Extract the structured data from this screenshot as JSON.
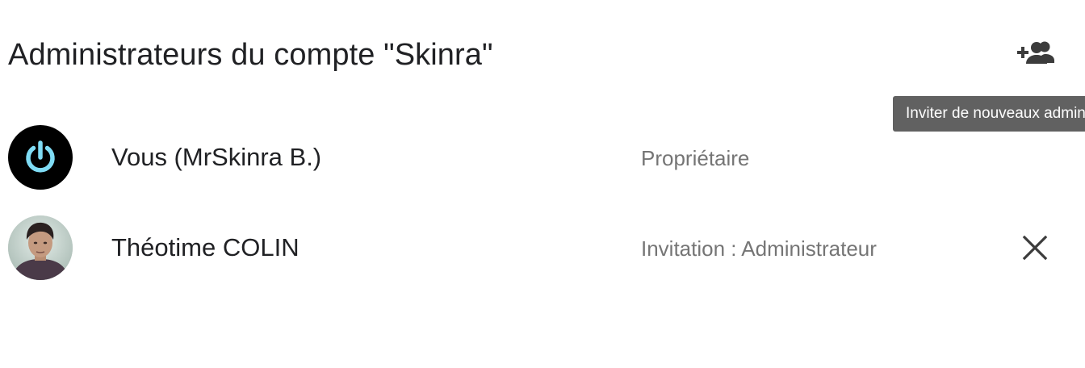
{
  "header": {
    "title": "Administrateurs du compte \"Skinra\"",
    "invite_icon": "person-add-icon",
    "tooltip": "Inviter de nouveaux administrateurs"
  },
  "admins": [
    {
      "name": "Vous (MrSkinra B.)",
      "role": "Propriétaire",
      "avatar_icon": "power-icon"
    },
    {
      "name": "Théotime COLIN",
      "role": "Invitation : Administrateur",
      "avatar_icon": "profile-photo",
      "remove_icon": "close-icon"
    }
  ],
  "colors": {
    "text_primary": "#202124",
    "text_secondary": "#757575",
    "tooltip_bg": "#616161",
    "power_icon": "#7fdcf5"
  }
}
